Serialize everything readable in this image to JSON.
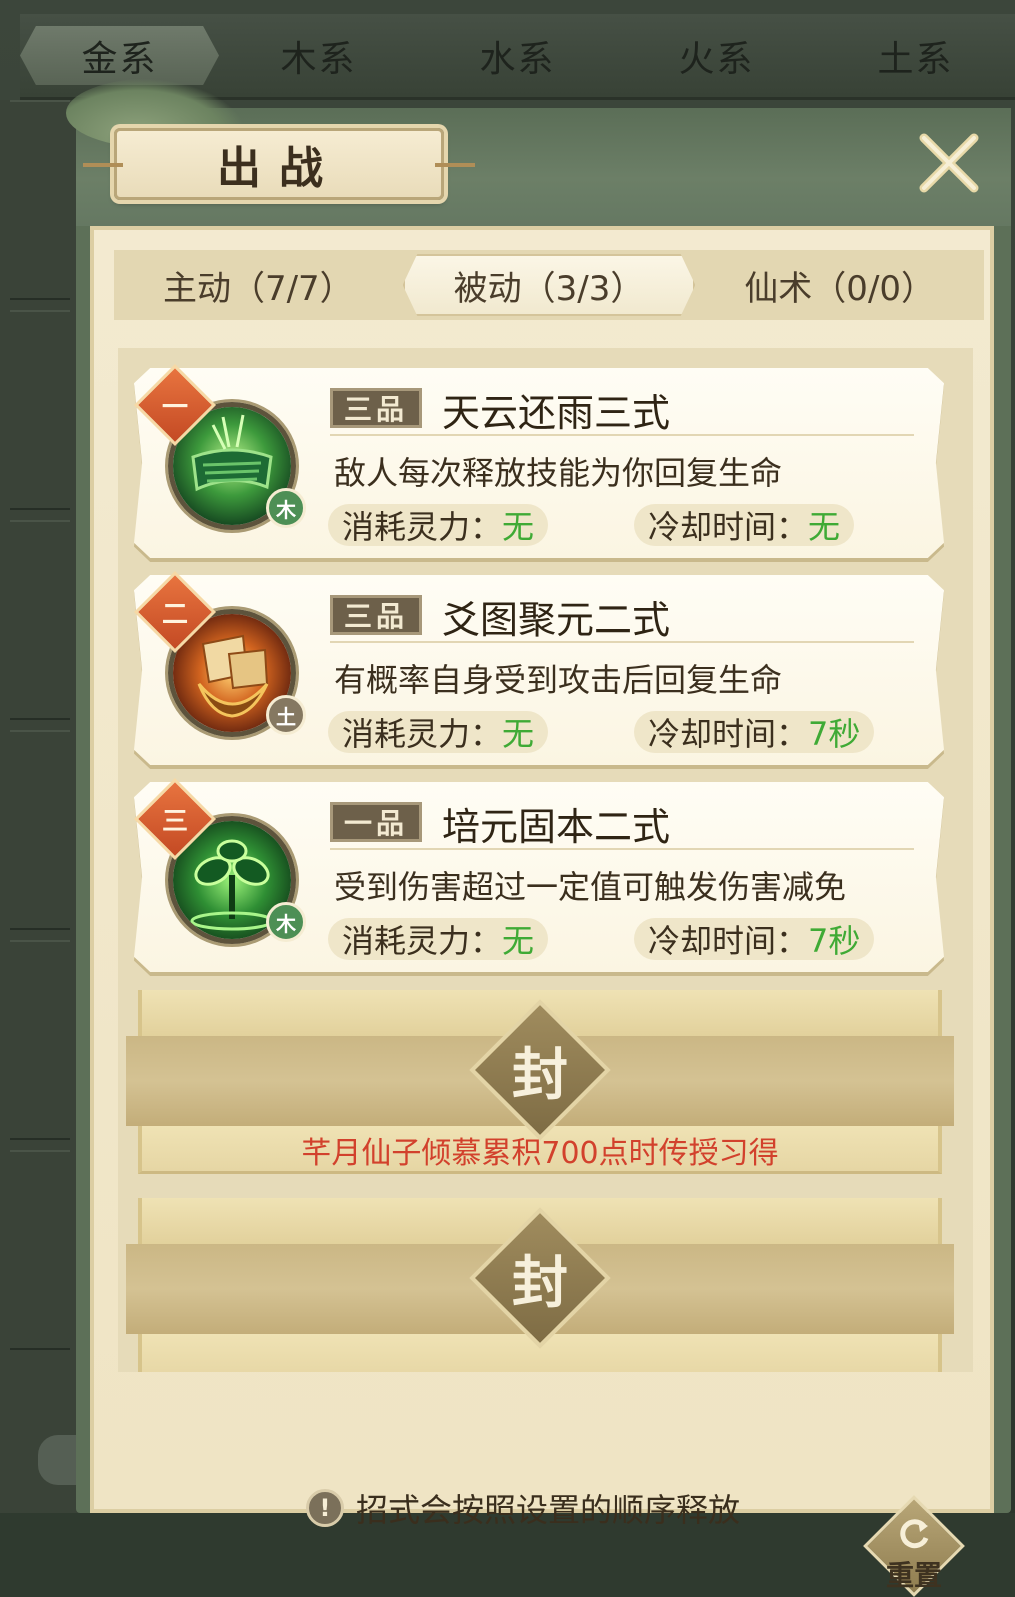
{
  "element_tabs": [
    {
      "label": "金系",
      "active": true
    },
    {
      "label": "木系",
      "active": false
    },
    {
      "label": "水系",
      "active": false
    },
    {
      "label": "火系",
      "active": false
    },
    {
      "label": "土系",
      "active": false
    }
  ],
  "dialog": {
    "title": "出战",
    "close_icon": "close-icon"
  },
  "sub_tabs": [
    {
      "label": "主动（7/7）",
      "active": false
    },
    {
      "label": "被动（3/3）",
      "active": true
    },
    {
      "label": "仙术（0/0）",
      "active": false
    }
  ],
  "skills": [
    {
      "order": "一",
      "grade": "三品",
      "name": "天云还雨三式",
      "desc": "敌人每次释放技能为你回复生命",
      "cost_label": "消耗灵力：",
      "cost_value": "无",
      "cd_label": "冷却时间：",
      "cd_value": "无",
      "element": "木",
      "icon": "green-scroll-icon"
    },
    {
      "order": "二",
      "grade": "三品",
      "name": "爻图聚元二式",
      "desc": "有概率自身受到攻击后回复生命",
      "cost_label": "消耗灵力：",
      "cost_value": "无",
      "cd_label": "冷却时间：",
      "cd_value": "7秒",
      "element": "土",
      "icon": "fire-talisman-icon"
    },
    {
      "order": "三",
      "grade": "一品",
      "name": "培元固本二式",
      "desc": "受到伤害超过一定值可触发伤害减免",
      "cost_label": "消耗灵力：",
      "cost_value": "无",
      "cd_label": "冷却时间：",
      "cd_value": "7秒",
      "element": "木",
      "icon": "sprout-icon"
    }
  ],
  "sealed_slots": [
    {
      "seal_char": "封",
      "unlock_text": "芊月仙子倾慕累积700点时传授习得"
    },
    {
      "seal_char": "封",
      "unlock_text": ""
    }
  ],
  "footer": {
    "hint_icon_glyph": "!",
    "hint": "招式会按照设置的顺序释放",
    "reset_label": "重置"
  },
  "colors": {
    "value_green": "#3faa35",
    "unlock_red": "#d2412c",
    "order_badge": "#d85a30",
    "dialog_green": "#5d7058"
  }
}
